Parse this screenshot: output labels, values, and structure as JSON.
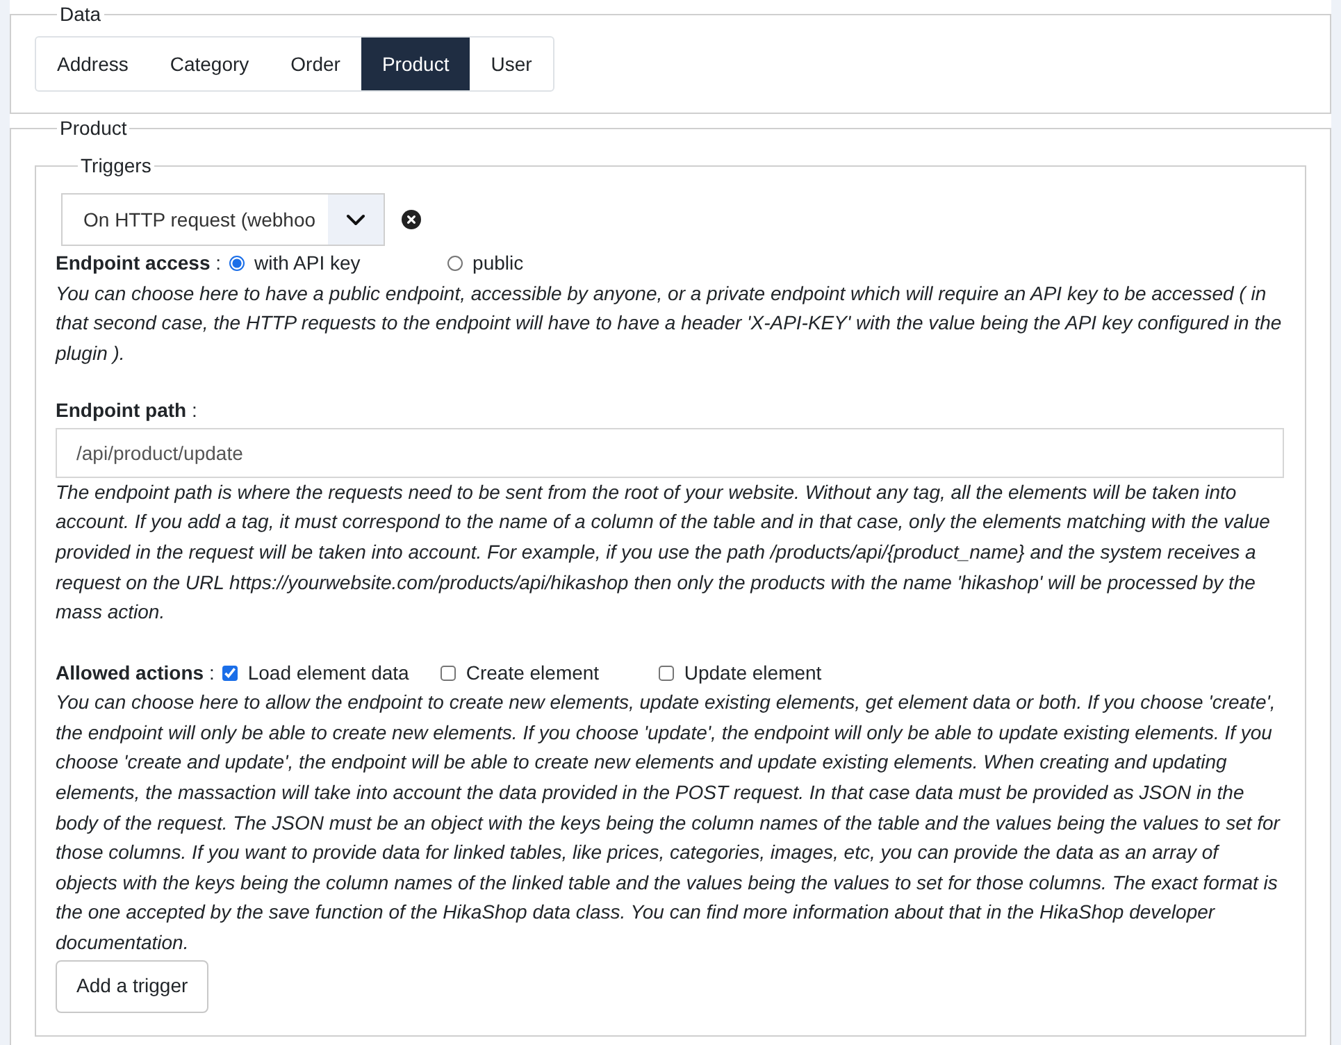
{
  "data_section": {
    "legend": "Data",
    "tabs": [
      {
        "label": "Address",
        "selected": false
      },
      {
        "label": "Category",
        "selected": false
      },
      {
        "label": "Order",
        "selected": false
      },
      {
        "label": "Product",
        "selected": true
      },
      {
        "label": "User",
        "selected": false
      }
    ]
  },
  "product_section": {
    "legend": "Product",
    "triggers": {
      "legend": "Triggers",
      "trigger_select": {
        "value": "On HTTP request (webhoo"
      },
      "endpoint_access": {
        "label": "**Endpoint access** :",
        "options": [
          {
            "label": "with API key",
            "selected": true
          },
          {
            "label": "public",
            "selected": false
          }
        ],
        "help": "You can choose here to have a public endpoint, accessible by anyone, or a private endpoint which will require an API key to be accessed ( in that second case, the HTTP requests to the endpoint will have to have a header 'X-API-KEY' with the value being the API key configured in the plugin )."
      },
      "endpoint_path": {
        "label": "**Endpoint path** :",
        "value": "/api/product/update",
        "help": "The endpoint path is where the requests need to be sent from the root of your website. Without any tag, all the elements will be taken into account. If you add a tag, it must correspond to the name of a column of the table and in that case, only the elements matching with the value provided in the request will be taken into account. For example, if you use the path /products/api/{product_name} and the system receives a request on the URL https://yourwebsite.com/products/api/hikashop then only the products with the name 'hikashop' will be processed by the mass action."
      },
      "allowed_actions": {
        "label": "**Allowed actions** :",
        "options": [
          {
            "label": "Load element data",
            "checked": true
          },
          {
            "label": "Create element",
            "checked": false
          },
          {
            "label": "Update element",
            "checked": false
          }
        ],
        "help": "You can choose here to allow the endpoint to create new elements, update existing elements, get element data or both. If you choose 'create', the endpoint will only be able to create new elements. If you choose 'update', the endpoint will only be able to update existing elements. If you choose 'create and update', the endpoint will be able to create new elements and update existing elements. When creating and updating elements, the massaction will take into account the data provided in the POST request. In that case data must be provided as JSON in the body of the request. The JSON must be an object with the keys being the column names of the table and the values being the values to set for those columns. If you want to provide data for linked tables, like prices, categories, images, etc, you can provide the data as an array of objects with the keys being the column names of the linked table and the values being the values to set for those columns. The exact format is the one accepted by the save function of the HikaShop data class. You can find more information about that in the HikaShop developer documentation."
      },
      "add_button": "Add a trigger"
    }
  }
}
